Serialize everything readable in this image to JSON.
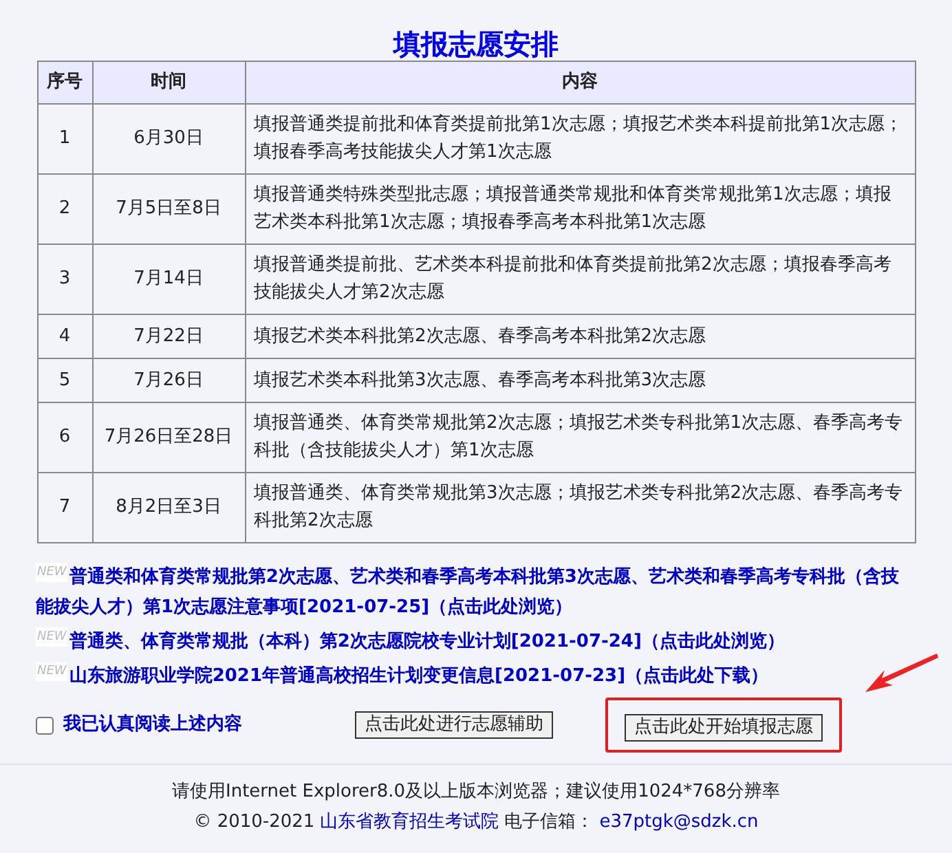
{
  "title": "填报志愿安排",
  "table": {
    "columns": [
      "序号",
      "时间",
      "内容"
    ],
    "rows": [
      {
        "no": "1",
        "date": "6月30日",
        "content": "填报普通类提前批和体育类提前批第1次志愿；填报艺术类本科提前批第1次志愿；填报春季高考技能拔尖人才第1次志愿"
      },
      {
        "no": "2",
        "date": "7月5日至8日",
        "content": "填报普通类特殊类型批志愿；填报普通类常规批和体育类常规批第1次志愿；填报艺术类本科批第1次志愿；填报春季高考本科批第1次志愿"
      },
      {
        "no": "3",
        "date": "7月14日",
        "content": "填报普通类提前批、艺术类本科提前批和体育类提前批第2次志愿；填报春季高考技能拔尖人才第2次志愿"
      },
      {
        "no": "4",
        "date": "7月22日",
        "content": "填报艺术类本科批第2次志愿、春季高考本科批第2次志愿"
      },
      {
        "no": "5",
        "date": "7月26日",
        "content": "填报艺术类本科批第3次志愿、春季高考本科批第3次志愿"
      },
      {
        "no": "6",
        "date": "7月26日至28日",
        "content": "填报普通类、体育类常规批第2次志愿；填报艺术类专科批第1次志愿、春季高考专科批（含技能拔尖人才）第1次志愿"
      },
      {
        "no": "7",
        "date": "8月2日至3日",
        "content": "填报普通类、体育类常规批第3次志愿；填报艺术类专科批第2次志愿、春季高考专科批第2次志愿"
      }
    ]
  },
  "notices": [
    {
      "badge": "NEW",
      "text": "普通类和体育类常规批第2次志愿、艺术类和春季高考本科批第3次志愿、艺术类和春季高考专科批（含技能拔尖人才）第1次志愿注意事项[2021-07-25]（点击此处浏览）"
    },
    {
      "badge": "NEW",
      "text": "普通类、体育类常规批（本科）第2次志愿院校专业计划[2021-07-24]（点击此处浏览）"
    },
    {
      "badge": "NEW",
      "text": "山东旅游职业学院2021年普通高校招生计划变更信息[2021-07-23]（点击此处下载）"
    }
  ],
  "agreement": {
    "label": "我已认真阅读上述内容",
    "checked": false
  },
  "buttons": [
    {
      "label": "点击此处进行志愿辅助",
      "highlighted": false
    },
    {
      "label": "点击此处开始填报志愿",
      "highlighted": true
    }
  ],
  "footer": {
    "browser_note": "请使用Internet Explorer8.0及以上版本浏览器；建议使用1024*768分辨率",
    "copyright": "© 2010-2021",
    "org_link": "山东省教育招生考试院",
    "email_label": "电子信箱：",
    "email": "e37ptgk@sdzk.cn"
  }
}
